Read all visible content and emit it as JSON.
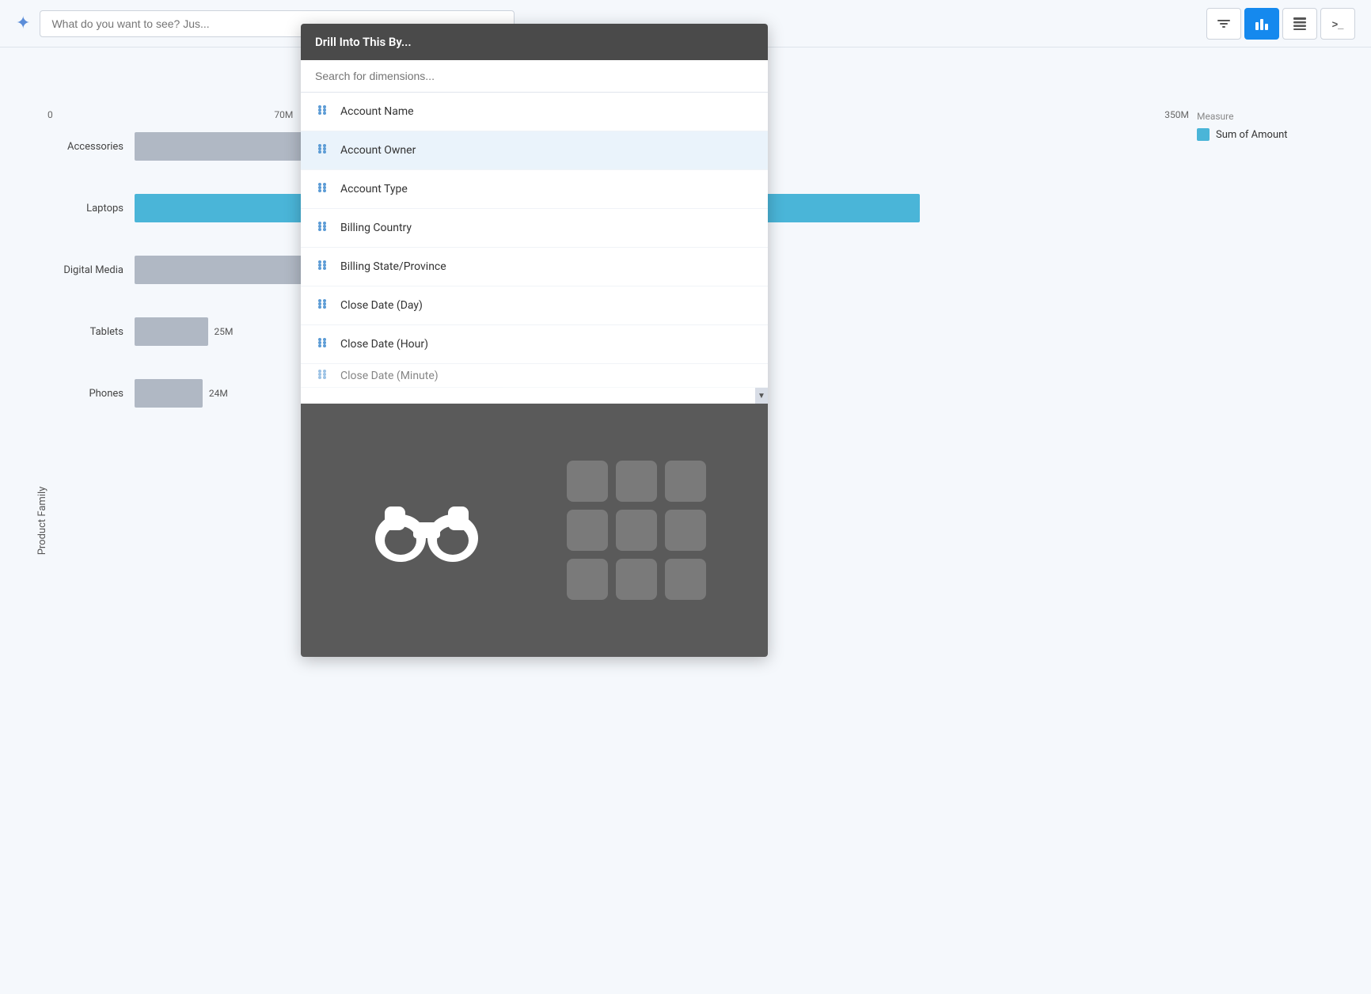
{
  "topbar": {
    "ai_icon": "✦",
    "search_placeholder": "What do you want to see? Jus...",
    "buttons": [
      {
        "id": "filter-btn",
        "icon": "⚙",
        "active": false,
        "label": "filter"
      },
      {
        "id": "chart-btn",
        "icon": "≡",
        "active": true,
        "label": "chart"
      },
      {
        "id": "table-btn",
        "icon": "⊞",
        "active": false,
        "label": "table"
      },
      {
        "id": "code-btn",
        "icon": ">_",
        "active": false,
        "label": "code"
      }
    ]
  },
  "chart": {
    "y_axis_label": "Product Family",
    "x_labels": [
      {
        "value": "0",
        "position": "0%"
      },
      {
        "value": "70M",
        "position": "20%"
      },
      {
        "value": "350M",
        "position": "100%"
      }
    ],
    "bars": [
      {
        "label": "Accessories",
        "width": "30%",
        "color": "gray",
        "value": ""
      },
      {
        "label": "Laptops",
        "width": "85%",
        "color": "blue",
        "value": ""
      },
      {
        "label": "Digital Media",
        "width": "22%",
        "color": "gray",
        "value": ""
      },
      {
        "label": "Tablets",
        "width": "7%",
        "color": "gray",
        "value": "25M"
      },
      {
        "label": "Phones",
        "width": "6.5%",
        "color": "gray",
        "value": "24M"
      }
    ]
  },
  "measure": {
    "title": "Measure",
    "items": [
      {
        "label": "Sum of Amount",
        "color": "#4ab5d8"
      }
    ]
  },
  "drill": {
    "title": "Drill Into This By...",
    "search_placeholder": "Search for dimensions...",
    "items": [
      {
        "label": "Account Name",
        "highlighted": false
      },
      {
        "label": "Account Owner",
        "highlighted": true
      },
      {
        "label": "Account Type",
        "highlighted": false
      },
      {
        "label": "Billing Country",
        "highlighted": false
      },
      {
        "label": "Billing State/Province",
        "highlighted": false
      },
      {
        "label": "Close Date (Day)",
        "highlighted": false
      },
      {
        "label": "Close Date (Hour)",
        "highlighted": false
      },
      {
        "label": "Close Date (Minute)",
        "highlighted": false
      }
    ],
    "icon": "⁘"
  }
}
